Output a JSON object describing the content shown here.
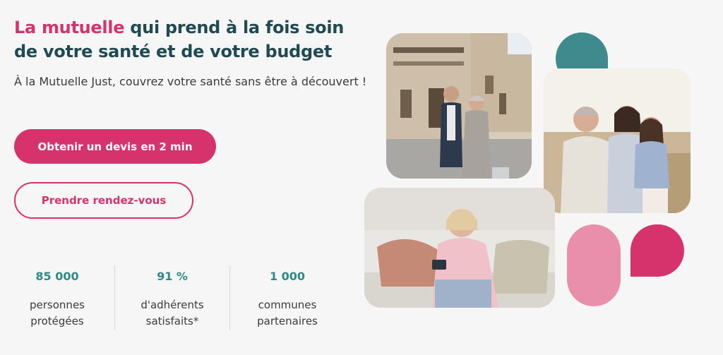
{
  "hero": {
    "headline_accent": "La mutuelle",
    "headline_rest": " qui prend à la fois soin de votre santé et de votre budget",
    "subtitle": "À la Mutuelle Just, couvrez votre santé sans être à découvert !"
  },
  "actions": {
    "primary_label": "Obtenir un devis en 2 min",
    "secondary_label": "Prendre rendez-vous"
  },
  "stats": [
    {
      "value": "85 000",
      "label_line1": "personnes",
      "label_line2": "protégées"
    },
    {
      "value": "91 %",
      "label_line1": "d'adhérents",
      "label_line2": "satisfaits*"
    },
    {
      "value": "1 000",
      "label_line1": "communes",
      "label_line2": "partenaires"
    }
  ],
  "colors": {
    "accent": "#d6336c",
    "teal": "#1f4a52",
    "stat_teal": "#2e8a85",
    "shape_teal": "#3e8a8d",
    "shape_pink_light": "#e98fab"
  }
}
